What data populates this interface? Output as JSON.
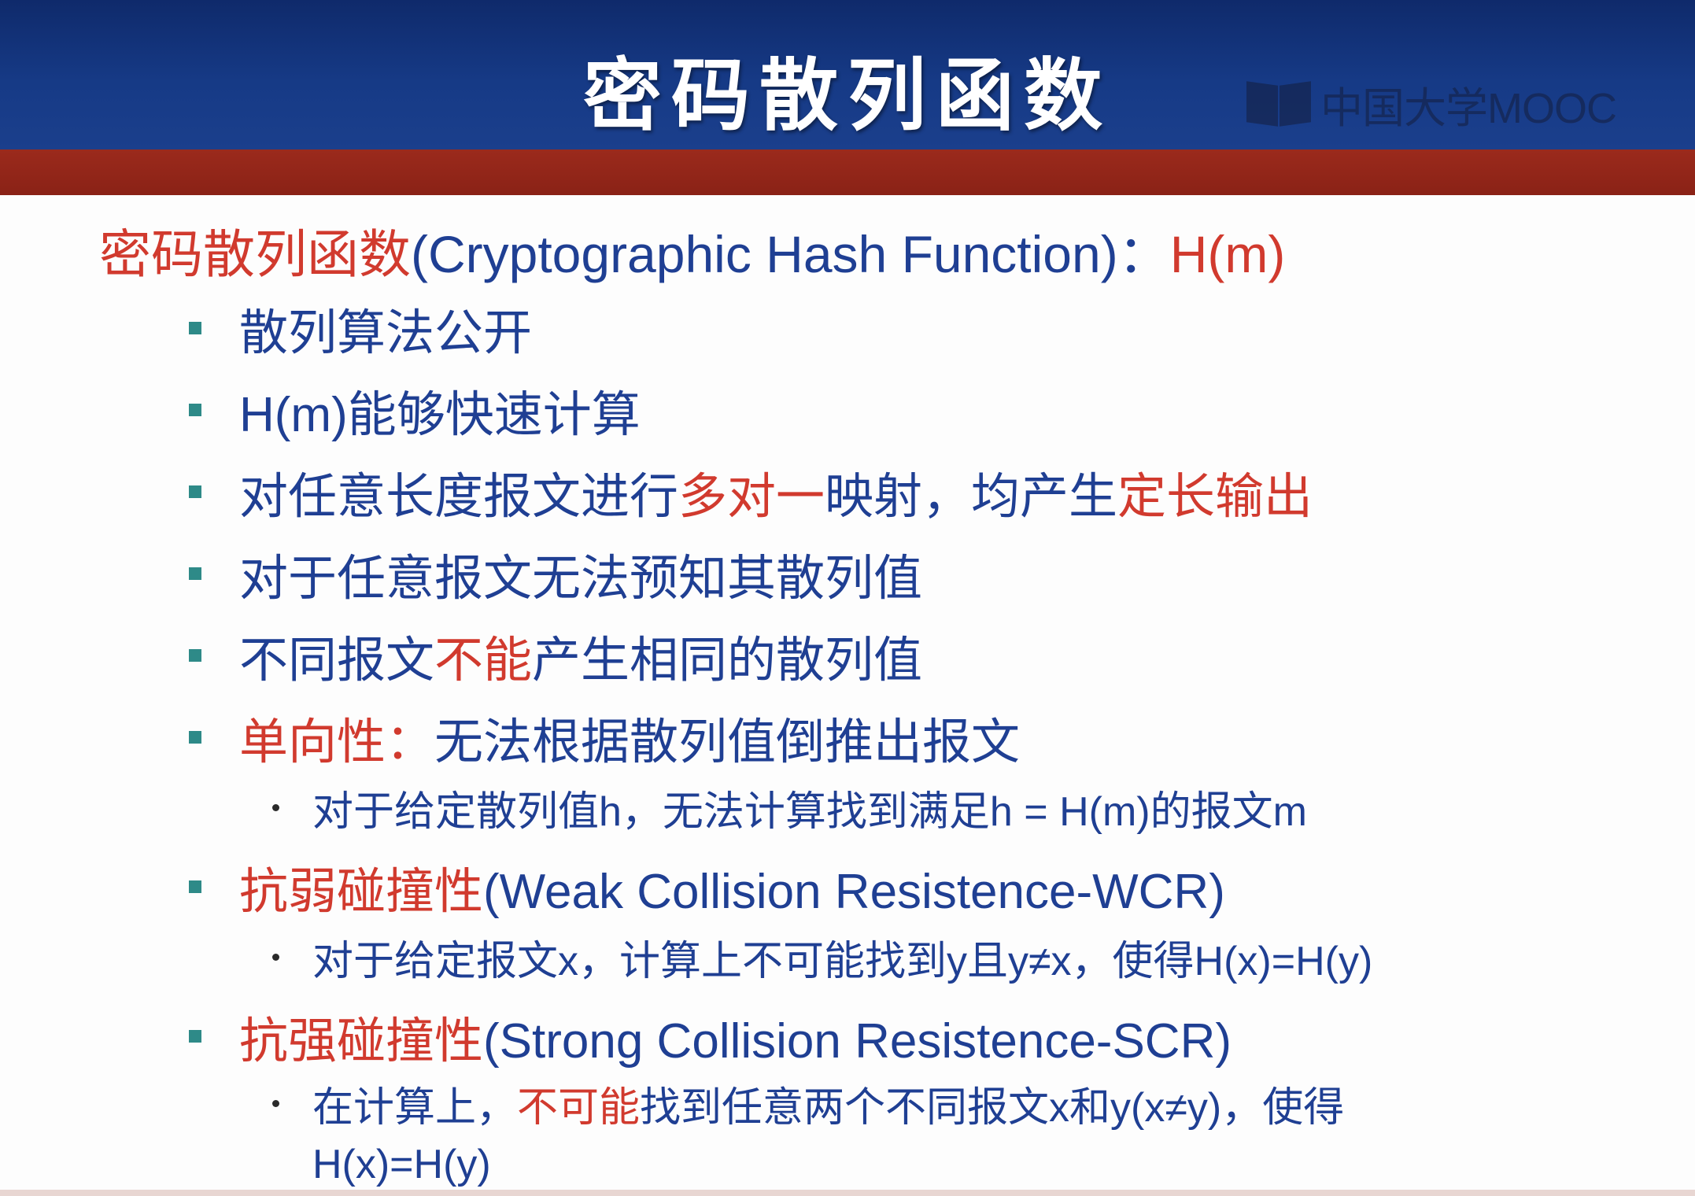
{
  "header": {
    "title": "密码散列函数",
    "watermark": "中国大学MOOC"
  },
  "heading": {
    "term": "密码散列函数",
    "english": "(Cryptographic Hash Function)：",
    "symbol": "H(m)"
  },
  "items": [
    {
      "text": "散列算法公开"
    },
    {
      "text": "H(m)能够快速计算"
    },
    {
      "parts": [
        "对任意长度报文进行",
        "多对一",
        "映射，均产生",
        "定长输出"
      ]
    },
    {
      "text": "对于任意报文无法预知其散列值"
    },
    {
      "parts": [
        "不同报文",
        "不能",
        "产生相同的散列值"
      ]
    },
    {
      "parts": [
        "单向性：",
        "无法根据散列值倒推出报文"
      ]
    },
    {
      "sub": "对于给定散列值h，无法计算找到满足h = H(m)的报文m"
    },
    {
      "parts": [
        "抗弱碰撞性",
        "(Weak Collision Resistence-WCR)"
      ]
    },
    {
      "sub": "对于给定报文x，计算上不可能找到y且y≠x，使得H(x)=H(y)"
    },
    {
      "parts": [
        "抗强碰撞性",
        "(Strong Collision Resistence-SCR)"
      ]
    },
    {
      "sub_parts": [
        "在计算上，",
        "不可能",
        "找到任意两个不同报文x和y(x≠y)，使得",
        "H(x)=H(y)"
      ]
    }
  ],
  "colors": {
    "header_blue": "#163a86",
    "header_red": "#8a2216",
    "text_blue": "#1f3f93",
    "highlight_red": "#d13a2e",
    "bullet_teal": "#2e8a88"
  }
}
